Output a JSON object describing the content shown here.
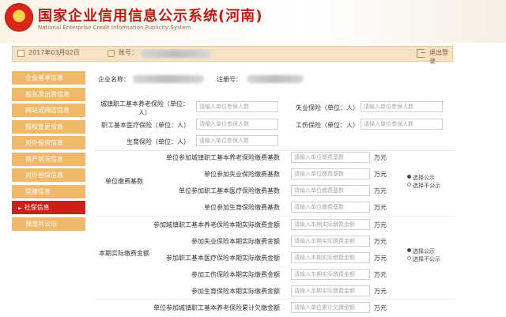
{
  "header": {
    "title_cn": "国家企业信用信息公示系统(河南)",
    "title_en": "National Enterprise Credit Information Publicity System"
  },
  "topbar": {
    "date": "2017年03月02日",
    "account_label": "账号：",
    "logout": "退出登录"
  },
  "sidebar": {
    "items": [
      {
        "label": "企业基本信息"
      },
      {
        "label": "股东及出资信息"
      },
      {
        "label": "网站或网店信息"
      },
      {
        "label": "股权变更信息"
      },
      {
        "label": "对外投资信息"
      },
      {
        "label": "资产状况信息"
      },
      {
        "label": "对外担保信息"
      },
      {
        "label": "党建信息"
      },
      {
        "label": "社保信息",
        "active": true
      },
      {
        "label": "预览并公示"
      }
    ]
  },
  "company": {
    "name_label": "企业名称：",
    "reg_label": "注册号："
  },
  "insured": {
    "placeholder": "请输入单位参保人数",
    "left": [
      {
        "label": "城镇职工基本养老保险（单位：人）"
      },
      {
        "label": "职工基本医疗保险（单位：人）"
      },
      {
        "label": "生育保险（单位：人）"
      }
    ],
    "right": [
      {
        "label": "失业保险（单位：人）"
      },
      {
        "label": "工伤保险（单位：人）"
      }
    ]
  },
  "base": {
    "group_label": "单位缴费基数",
    "placeholder": "请输入单位缴费基数",
    "unit": "万元",
    "rows": [
      {
        "label": "单位参加城镇职工基本养老保险缴费基数"
      },
      {
        "label": "单位参加失业保险缴费基数"
      },
      {
        "label": "单位参加职工基本医疗保险缴费基数"
      },
      {
        "label": "单位参加生育保险缴费基数"
      }
    ]
  },
  "actual": {
    "group_label": "本期实际缴费金额",
    "placeholder": "请输入本期实际缴费金额",
    "unit": "万元",
    "rows": [
      {
        "label": "参加城镇职工基本养老保险本期实际缴费金额"
      },
      {
        "label": "参加失业保险本期实际缴费金额"
      },
      {
        "label": "参加职工基本医疗保险本期实际缴费金额"
      },
      {
        "label": "参加工伤保险本期实际缴费金额"
      },
      {
        "label": "参加生育保险本期实际缴费金额"
      }
    ]
  },
  "arrears": {
    "label": "单位参加城镇职工基本养老保险累计欠缴金额",
    "placeholder": "请输入单位累计欠缴金额",
    "unit": "万元"
  },
  "publicity": {
    "option_public": "选择公示",
    "option_private": "选择不公示"
  }
}
